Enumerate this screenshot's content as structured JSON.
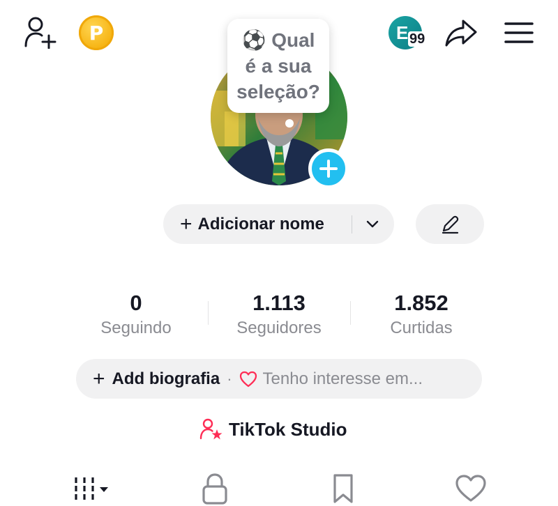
{
  "top_bar": {
    "add_friend_icon": "person-plus-icon",
    "coin_icon": "points-coin-icon",
    "coin_letter": "P",
    "notification_avatar_letter": "E",
    "notification_count": "99",
    "share_icon": "share-arrow-icon",
    "menu_icon": "hamburger-menu-icon"
  },
  "avatar": {
    "bubble_emoji": "⚽",
    "bubble_line1": "Qual",
    "bubble_line2": "é a sua",
    "bubble_line3": "seleção?",
    "add_icon": "plus-icon"
  },
  "name_row": {
    "add_name_plus": "+",
    "add_name_label": "Adicionar nome",
    "edit_icon": "pencil-icon"
  },
  "stats": {
    "following_count": "0",
    "following_label": "Seguindo",
    "followers_count": "1.113",
    "followers_label": "Seguidores",
    "likes_count": "1.852",
    "likes_label": "Curtidas"
  },
  "bio": {
    "plus": "+",
    "add_bio_label": "Add biografia",
    "separator": "·",
    "interest_text": "Tenho interesse em..."
  },
  "studio": {
    "label": "TikTok Studio"
  },
  "tabs": [
    {
      "name": "videos",
      "icon": "grid-bars-icon"
    },
    {
      "name": "private",
      "icon": "lock-icon"
    },
    {
      "name": "saved",
      "icon": "bookmark-icon"
    },
    {
      "name": "liked",
      "icon": "heart-icon"
    }
  ],
  "colors": {
    "accent_blue": "#22bff0",
    "accent_red": "#fe2c55",
    "pill_bg": "#f1f1f2",
    "coin_gold": "#f6b312",
    "teal": "#1aa4a4"
  }
}
